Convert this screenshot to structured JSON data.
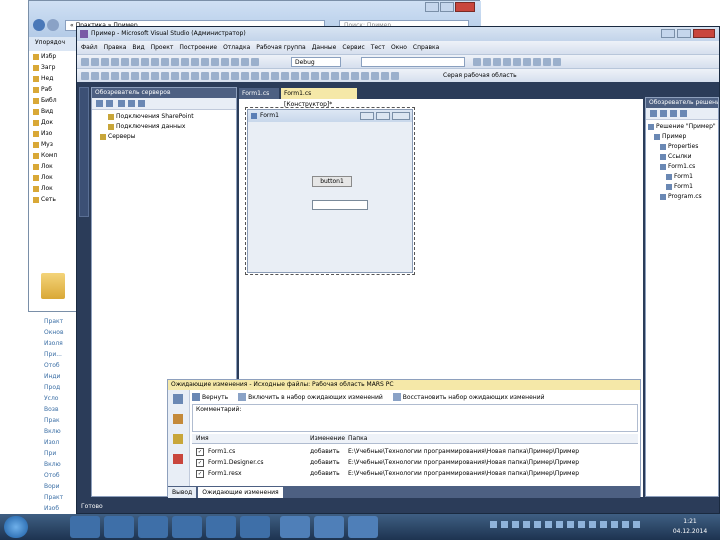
{
  "explorer": {
    "organize": "Упорядоч",
    "nav": [
      "Избр",
      "Загр",
      "Нед",
      "Раб",
      "Библ",
      "Вид",
      "Док",
      "Изо",
      "Муз",
      "Комп",
      "Лок",
      "Лок",
      "Лок",
      "Сеть"
    ],
    "search_placeholder": "Поиск: Пример",
    "path": "« Практика » Пример"
  },
  "doc_lines": [
    "Практ",
    "Окнов",
    "Изоля",
    "При...",
    "Отоб",
    "Инди",
    "Прод",
    "Усло",
    "Возв",
    "Прак",
    "Вклю",
    "Изол",
    "При",
    "Вклю",
    "Отоб",
    "Вори",
    "Практ",
    "Изоб"
  ],
  "vs": {
    "title": "Пример - Microsoft Visual Studio (Администратор)",
    "menu": [
      "Файл",
      "Правка",
      "Вид",
      "Проект",
      "Построение",
      "Отладка",
      "Рабочая группа",
      "Данные",
      "Сервис",
      "Тест",
      "Окно",
      "Справка"
    ],
    "config": "Debug",
    "toolbar_label": "Серая рабочая область",
    "server_explorer": {
      "title": "Обозреватель серверов",
      "items": [
        "Подключения SharePoint",
        "Подключения данных",
        "Серверы"
      ]
    },
    "tabs": [
      "Form1.cs",
      "Form1.cs [Конструктор]*"
    ],
    "form": {
      "title": "Form1",
      "button": "button1"
    },
    "solution": {
      "title": "Обозреватель решений",
      "items": [
        "Решение \"Пример\"",
        "Пример",
        "Properties",
        "Ссылки",
        "Form1.cs",
        "Form1",
        "Form1",
        "Program.cs"
      ]
    },
    "pending": {
      "title": "Ожидающие изменения - Исходные файлы: Рабочая область MARS PC",
      "toolbar": [
        "Вернуть",
        "Включить в набор ожидающих изменений",
        "Восстановить набор ожидающих изменений"
      ],
      "comment_label": "Комментарий:",
      "col_name": "Имя",
      "col_change": "Изменение",
      "col_folder": "Папка",
      "rows": [
        {
          "name": "Form1.cs",
          "change": "добавить",
          "folder": "E:\\Учебные\\Технологии программирования\\Новая папка\\Пример\\Пример"
        },
        {
          "name": "Form1.Designer.cs",
          "change": "добавить",
          "folder": "E:\\Учебные\\Технологии программирования\\Новая папка\\Пример\\Пример"
        },
        {
          "name": "Form1.resx",
          "change": "добавить",
          "folder": "E:\\Учебные\\Технологии программирования\\Новая папка\\Пример\\Пример"
        }
      ],
      "bottom_tabs": [
        "Вывод",
        "Ожидающие изменения"
      ]
    },
    "status": "Готово"
  },
  "clock": {
    "time": "1:21",
    "date": "04.12.2014"
  },
  "colors": {
    "vs_dark": "#2b3c59",
    "taskbar": "#1d3350",
    "accent": "#3a6ea5"
  }
}
